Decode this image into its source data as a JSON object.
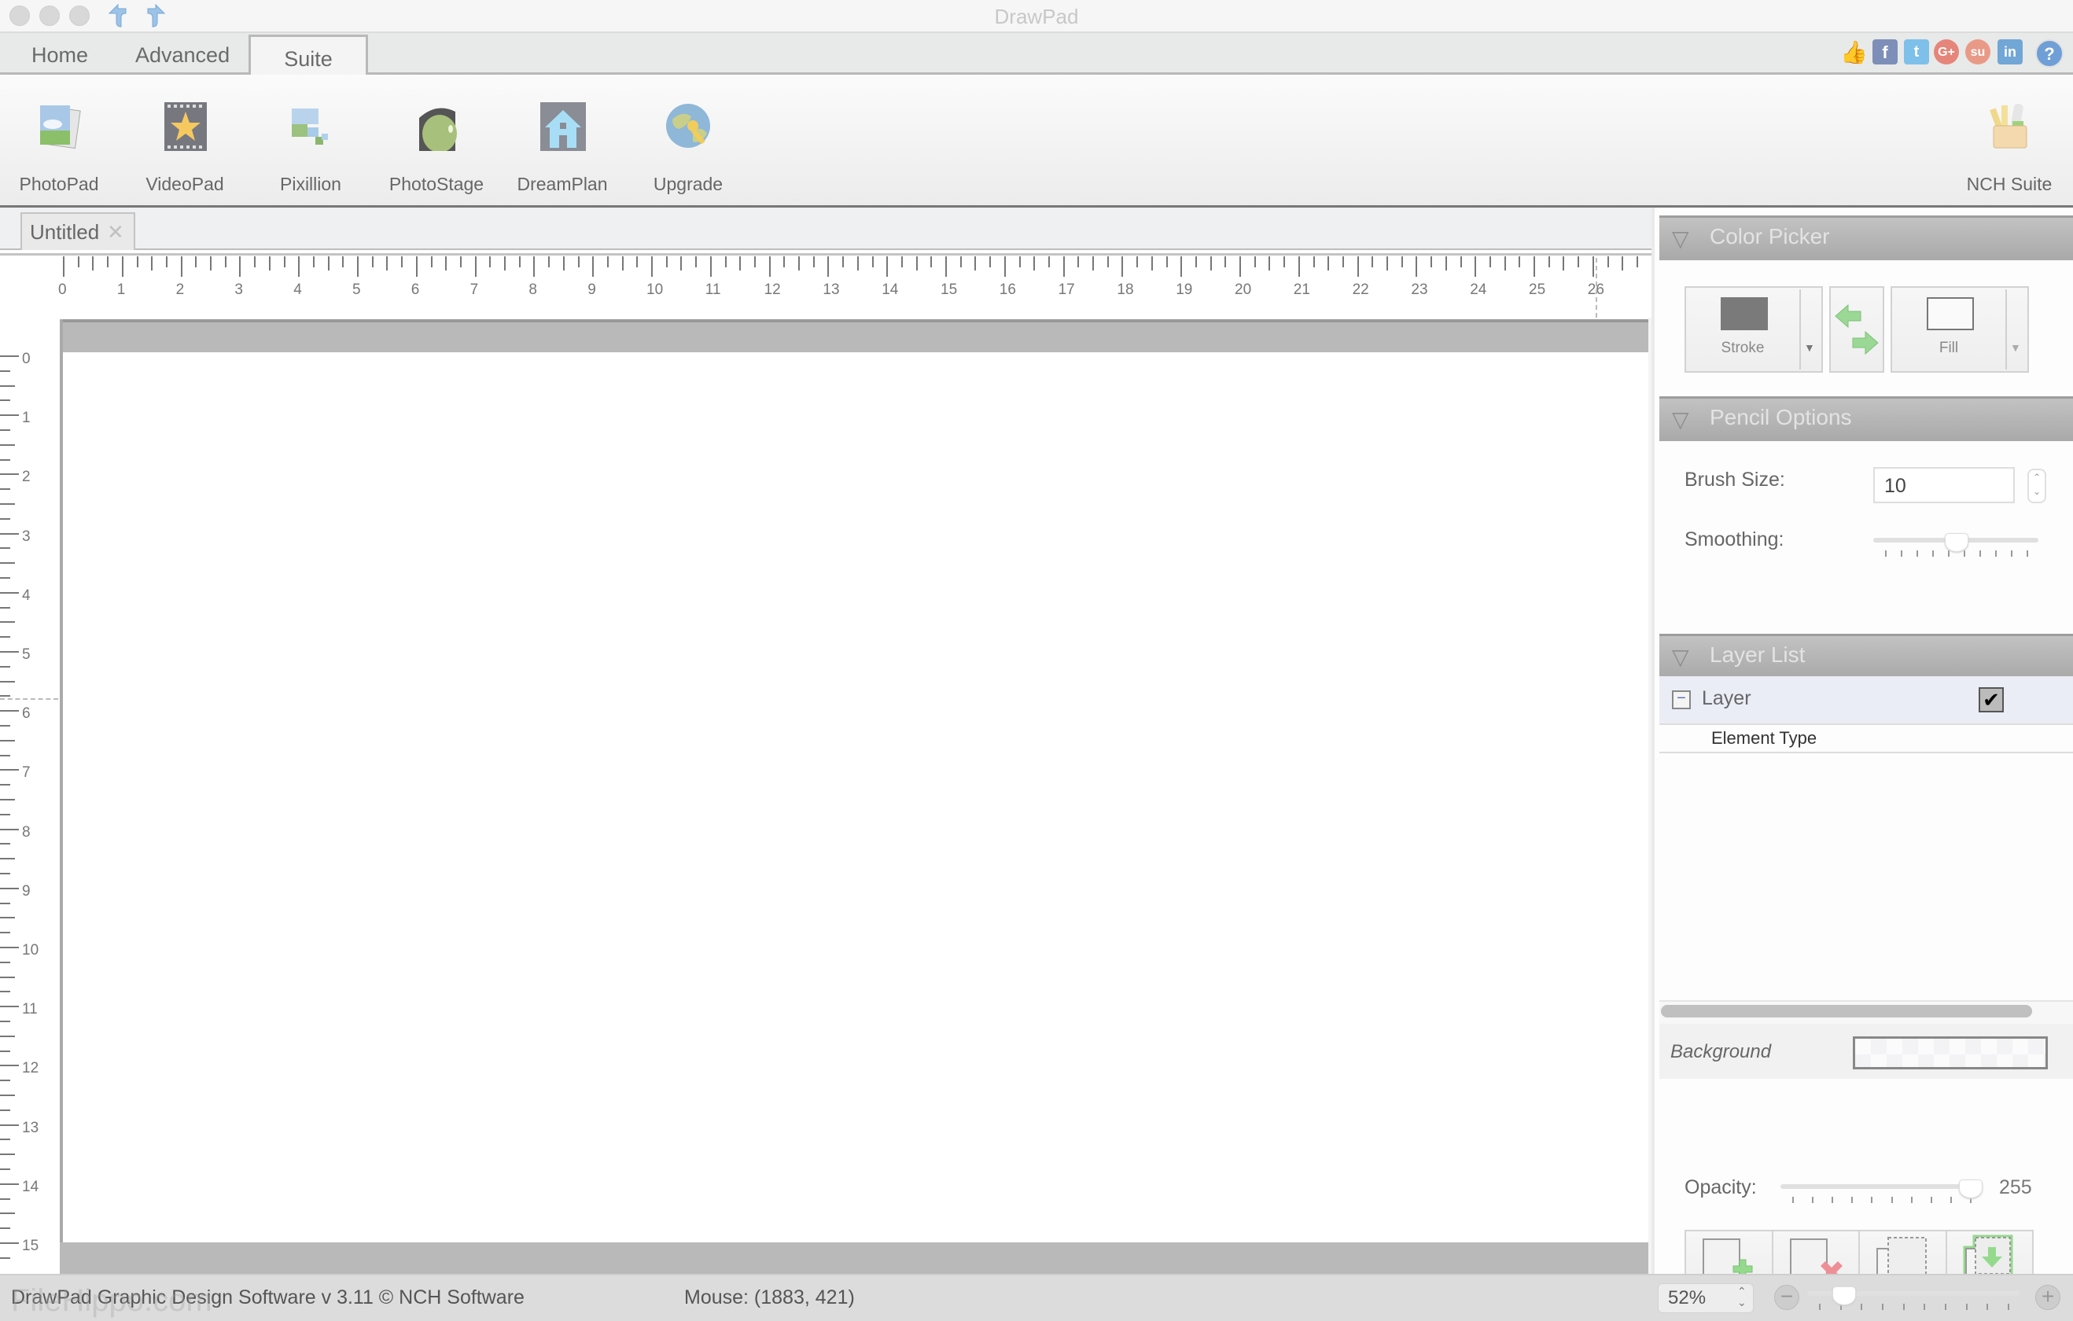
{
  "window": {
    "title": "DrawPad",
    "traffic_lights": [
      "close",
      "minimize",
      "zoom"
    ],
    "undo_icon": "undo-arrow-icon",
    "redo_icon": "redo-arrow-icon"
  },
  "ribbon": {
    "tabs": [
      {
        "label": "Home",
        "active": false
      },
      {
        "label": "Advanced",
        "active": false
      },
      {
        "label": "Suite",
        "active": true
      }
    ],
    "social_icons": [
      {
        "name": "like-icon",
        "glyph": "👍",
        "color": "#8fa3c4"
      },
      {
        "name": "facebook-icon",
        "glyph": "f",
        "color": "#7d8fb8"
      },
      {
        "name": "twitter-icon",
        "glyph": "t",
        "color": "#7ec0ea"
      },
      {
        "name": "googleplus-icon",
        "glyph": "G+",
        "color": "#e6857a"
      },
      {
        "name": "stumbleupon-icon",
        "glyph": "su",
        "color": "#e99a87"
      },
      {
        "name": "linkedin-icon",
        "glyph": "in",
        "color": "#72a6d6"
      },
      {
        "name": "help-icon",
        "glyph": "?",
        "color": "#6f9fd6"
      }
    ]
  },
  "toolbar": {
    "items": [
      {
        "label": "PhotoPad",
        "icon": "photopad-icon"
      },
      {
        "label": "VideoPad",
        "icon": "videopad-icon"
      },
      {
        "label": "Pixillion",
        "icon": "pixillion-icon"
      },
      {
        "label": "PhotoStage",
        "icon": "photostage-icon"
      },
      {
        "label": "DreamPlan",
        "icon": "dreamplan-icon"
      },
      {
        "label": "Upgrade",
        "icon": "upgrade-icon"
      }
    ],
    "nch_suite": {
      "label": "NCH Suite",
      "icon": "nch-suite-icon"
    }
  },
  "document": {
    "tab_label": "Untitled",
    "tab_close": "✕"
  },
  "rulers": {
    "horizontal_labels": [
      "0",
      "1",
      "2",
      "3",
      "4",
      "5",
      "6",
      "7",
      "8",
      "9",
      "10",
      "11",
      "12",
      "13",
      "14",
      "15",
      "16",
      "17",
      "18",
      "19",
      "20",
      "21",
      "22",
      "23",
      "24",
      "25",
      "26"
    ],
    "vertical_labels": [
      "0",
      "1",
      "2",
      "3",
      "4",
      "5",
      "6",
      "7",
      "8",
      "9",
      "10",
      "11",
      "12",
      "13",
      "14",
      "15"
    ],
    "mouse_marker_h": 26.0,
    "mouse_marker_v": 5.8
  },
  "color_picker": {
    "title": "Color Picker",
    "stroke_label": "Stroke",
    "fill_label": "Fill",
    "stroke_color": "#7a7a7a",
    "fill_color": "#fafafa",
    "swap_icon": "swap-colors-icon"
  },
  "pencil_options": {
    "title": "Pencil Options",
    "brush_size_label": "Brush Size:",
    "brush_size_value": "10",
    "smoothing_label": "Smoothing:",
    "smoothing_fraction": 0.5
  },
  "layer_list": {
    "title": "Layer List",
    "layers": [
      {
        "name": "Layer",
        "visible": true,
        "expanded": true
      }
    ],
    "column_header": "Element Type",
    "background_label": "Background",
    "opacity_label": "Opacity:",
    "opacity_value": "255",
    "opacity_fraction": 1.0,
    "buttons": [
      {
        "name": "add-layer-button",
        "icon": "add-layer-icon"
      },
      {
        "name": "delete-layer-button",
        "icon": "delete-layer-icon"
      },
      {
        "name": "duplicate-layer-button",
        "icon": "duplicate-layer-icon"
      },
      {
        "name": "merge-layer-button",
        "icon": "merge-down-icon"
      }
    ]
  },
  "status": {
    "copyright": "DrawPad Graphic Design Software v 3.11 © NCH Software",
    "mouse": "Mouse: (1883, 421)",
    "zoom_value": "52%",
    "zoom_fraction": 0.13,
    "watermark": "FileHippo.com"
  }
}
